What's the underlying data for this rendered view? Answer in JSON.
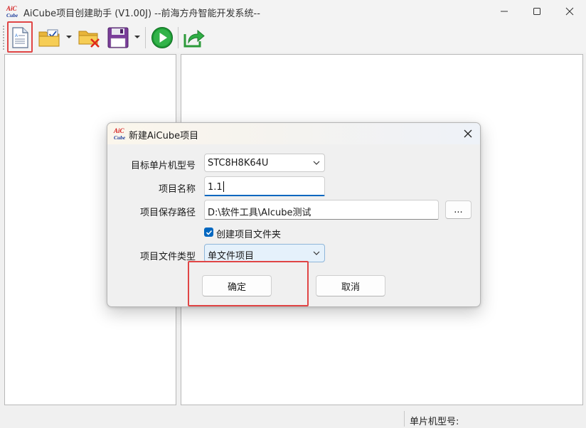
{
  "window": {
    "title": "AiCube项目创建助手 (V1.00J) --前海方舟智能开发系统--",
    "logo_text_top": "AiC",
    "logo_text_bottom": "Cube"
  },
  "toolbar": {
    "items": [
      {
        "name": "new-project",
        "icon": "new-document-icon"
      },
      {
        "name": "open-project",
        "icon": "open-folder-check-icon",
        "dropdown": true
      },
      {
        "name": "close-project",
        "icon": "folder-delete-icon"
      },
      {
        "name": "save-project",
        "icon": "floppy-disk-icon",
        "dropdown": true
      },
      {
        "name": "run",
        "icon": "green-play-icon"
      },
      {
        "name": "export",
        "icon": "share-export-icon"
      }
    ],
    "highlight_color": "#e04545"
  },
  "statusbar": {
    "mcu_model_label": "单片机型号:"
  },
  "dialog": {
    "title": "新建AiCube项目",
    "mcu_label": "目标单片机型号",
    "mcu_value": "STC8H8K64U",
    "name_label": "项目名称",
    "name_value": "1.1",
    "path_label": "项目保存路径",
    "path_value": "D:\\软件工具\\AIcube测试",
    "browse_label": "...",
    "create_folder_label": "创建项目文件夹",
    "create_folder_checked": true,
    "type_label": "项目文件类型",
    "type_value": "单文件项目",
    "ok_label": "确定",
    "cancel_label": "取消"
  },
  "colors": {
    "accent": "#0067c0",
    "highlight": "#e04545"
  }
}
